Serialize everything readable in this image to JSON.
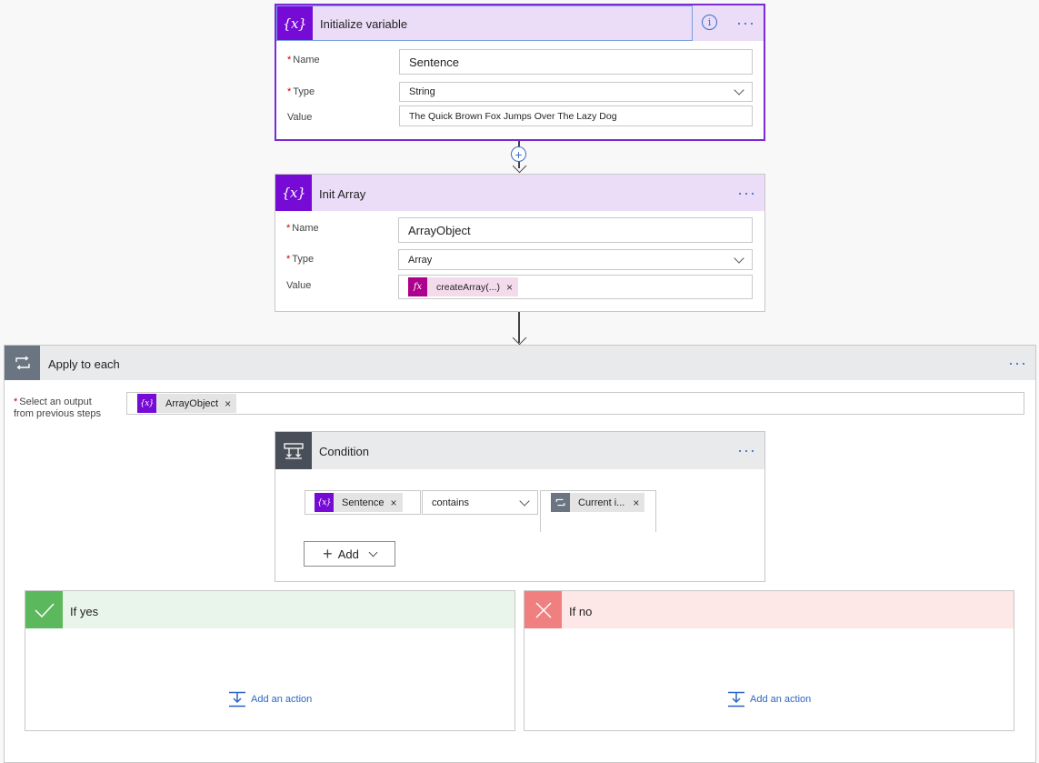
{
  "init_variable": {
    "title": "Initialize variable",
    "name_label": "Name",
    "name_value": "Sentence",
    "type_label": "Type",
    "type_value": "String",
    "value_label": "Value",
    "value_value": "The Quick Brown Fox Jumps Over The Lazy Dog",
    "required_mark": "*"
  },
  "init_array": {
    "title": "Init Array",
    "name_label": "Name",
    "name_value": "ArrayObject",
    "type_label": "Type",
    "type_value": "Array",
    "value_label": "Value",
    "value_token": "createArray(...)",
    "required_mark": "*"
  },
  "apply_each": {
    "title": "Apply to each",
    "select_label_line1": "Select an output",
    "select_label_line2": "from previous steps",
    "required_mark": "*",
    "token": "ArrayObject"
  },
  "condition": {
    "title": "Condition",
    "left_token": "Sentence",
    "operator": "contains",
    "right_token": "Current i...",
    "add_label": "Add"
  },
  "if_yes": {
    "title": "If yes",
    "add_action": "Add an action",
    "color": "#5cb85c"
  },
  "if_no": {
    "title": "If no",
    "add_action": "Add an action",
    "color": "#f08080"
  },
  "icons": {
    "variable": "{x}",
    "fx": "fx",
    "more": "···",
    "close": "×",
    "plus": "+",
    "info": "i"
  },
  "colors": {
    "variable_purple": "#770bd6",
    "variable_header_bg": "#ebdcf7",
    "fx_magenta": "#ad008c",
    "loop_gray": "#6b7481",
    "condition_dark": "#484f58",
    "link_blue": "#2b66c0"
  }
}
